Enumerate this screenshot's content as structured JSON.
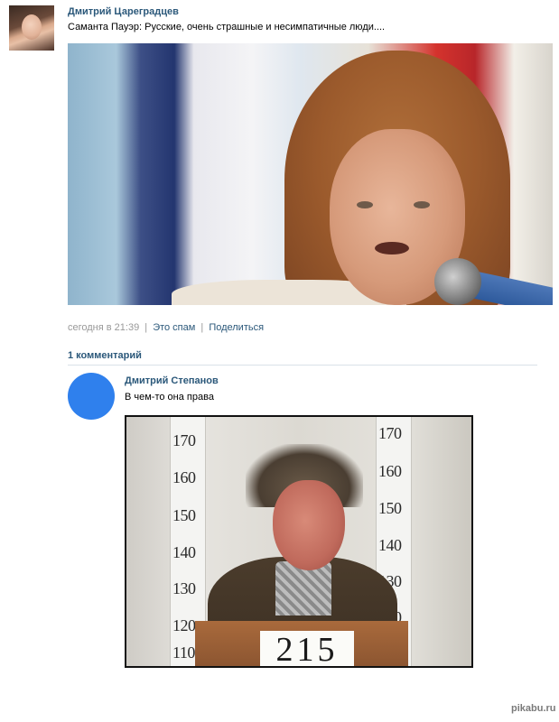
{
  "post": {
    "author_name": "Дмитрий Цареградцев",
    "text": "Саманта Пауэр: Русские, очень страшные и несимпатичные люди....",
    "timestamp": "сегодня в 21:39",
    "spam_label": "Это спам",
    "share_label": "Поделиться",
    "separator": "|"
  },
  "comments": {
    "header": "1 комментарий",
    "items": [
      {
        "author_name": "Дмитрий Степанов",
        "text": "В чем-то она права",
        "photo": {
          "ruler_left": [
            "170",
            "160",
            "150",
            "140",
            "130",
            "120",
            "110"
          ],
          "ruler_right": [
            "170",
            "160",
            "150",
            "140",
            "130",
            "120"
          ],
          "plate_number": "215"
        }
      }
    ]
  },
  "watermark": "pikabu.ru",
  "colors": {
    "link": "#2b587a",
    "meta": "#999999",
    "avatar_blue": "#2f80ed",
    "divider": "#dae1e8"
  }
}
